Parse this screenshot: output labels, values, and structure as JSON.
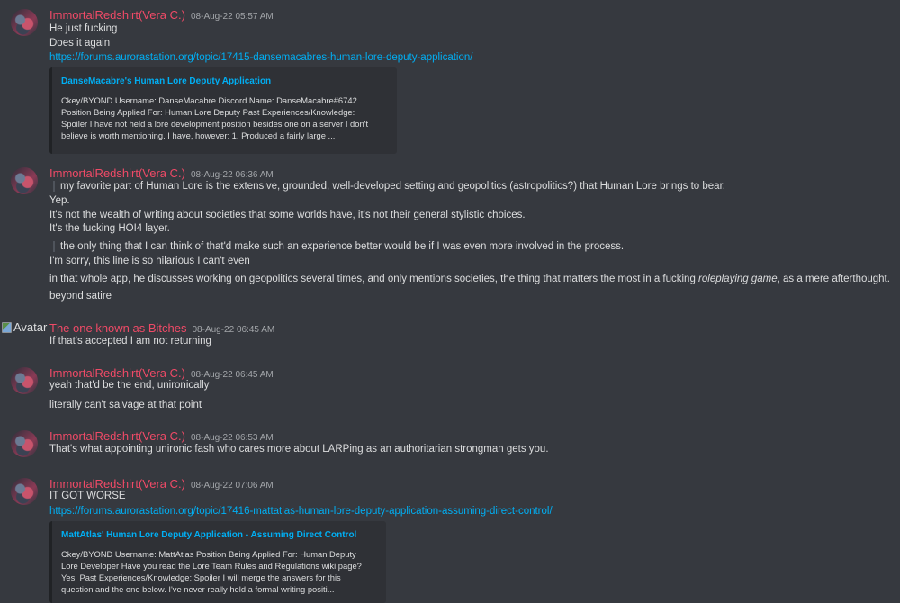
{
  "messages": [
    {
      "username": "ImmortalRedshirt(Vera C.)",
      "timestamp": "08-Aug-22 05:57 AM",
      "lines": [
        "He just fucking",
        "Does it again"
      ],
      "link": "https://forums.aurorastation.org/topic/17415-dansemacabres-human-lore-deputy-application/",
      "embed": {
        "title": "DanseMacabre's Human Lore Deputy Application",
        "description": "Ckey/BYOND Username: DanseMacabre Discord Name: DanseMacabre#6742\nPosition Being Applied For: Human Lore Deputy Past Experiences/Knowledge:\nSpoiler I have not held a lore development position besides one on a server I don't\nbelieve is worth mentioning. I have, however: 1. Produced a fairly large ..."
      }
    },
    {
      "username": "ImmortalRedshirt(Vera C.)",
      "timestamp": "08-Aug-22 06:36 AM",
      "quote1": "my favorite part of Human Lore is the extensive, grounded, well-developed setting and geopolitics (astropolitics?) that Human Lore brings to bear.",
      "lines": [
        "Yep.",
        "It's not the wealth of writing about societies that some worlds have, it's not their general stylistic choices.",
        "It's the fucking HOI4 layer."
      ],
      "quote2": "the only thing that I can think of that'd make such an experience better would be if I was even more involved in the process.",
      "line_after_quote": "I'm sorry, this line is so hilarious I can't even",
      "line_long_pre": "in that whole app, he discusses working on geopolitics several times, and only mentions societies, the thing that matters the most in a fucking ",
      "line_long_em": "roleplaying game",
      "line_long_post": ", as a mere afterthought.",
      "line_last": "beyond satire"
    },
    {
      "avatar_alt": "Avatar",
      "username": "The one known as Bitches",
      "timestamp": "08-Aug-22 06:45 AM",
      "lines": [
        "If that's accepted I am not returning"
      ]
    },
    {
      "username": "ImmortalRedshirt(Vera C.)",
      "timestamp": "08-Aug-22 06:45 AM",
      "lines": [
        "yeah that'd be the end, unironically",
        "literally can't salvage at that point"
      ]
    },
    {
      "username": "ImmortalRedshirt(Vera C.)",
      "timestamp": "08-Aug-22 06:53 AM",
      "lines": [
        "That's what appointing unironic fash who cares more about LARPing as an authoritarian strongman gets you."
      ]
    },
    {
      "username": "ImmortalRedshirt(Vera C.)",
      "timestamp": "08-Aug-22 07:06 AM",
      "lines": [
        "IT GOT WORSE"
      ],
      "link": "https://forums.aurorastation.org/topic/17416-mattatlas-human-lore-deputy-application-assuming-direct-control/",
      "embed": {
        "title": "MattAtlas' Human Lore Deputy Application - Assuming Direct Control",
        "description": "Ckey/BYOND Username: MattAtlas Position Being Applied For: Human Deputy\nLore Developer Have you read the Lore Team Rules and Regulations wiki page?\nYes. Past Experiences/Knowledge: Spoiler I will merge the answers for this\nquestion and the one below. I've never really held a formal writing positi..."
      }
    }
  ],
  "colors": {
    "background": "#36393f",
    "username": "#f04a67",
    "link": "#00aff4",
    "embed_bg": "#2f3136",
    "text": "#dcddde",
    "timestamp": "#a3a6aa"
  }
}
